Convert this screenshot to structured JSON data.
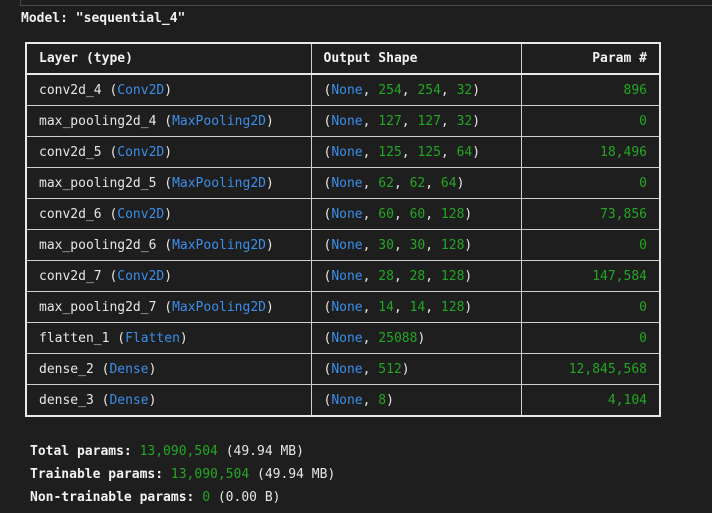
{
  "model_title": "Model: \"sequential_4\"",
  "headers": {
    "layer": "Layer (type)",
    "output_shape": "Output Shape",
    "params": "Param #"
  },
  "rows": [
    {
      "name": "conv2d_4",
      "type": "Conv2D",
      "shape": [
        "None",
        "254",
        "254",
        "32"
      ],
      "params": "896"
    },
    {
      "name": "max_pooling2d_4",
      "type": "MaxPooling2D",
      "shape": [
        "None",
        "127",
        "127",
        "32"
      ],
      "params": "0"
    },
    {
      "name": "conv2d_5",
      "type": "Conv2D",
      "shape": [
        "None",
        "125",
        "125",
        "64"
      ],
      "params": "18,496"
    },
    {
      "name": "max_pooling2d_5",
      "type": "MaxPooling2D",
      "shape": [
        "None",
        "62",
        "62",
        "64"
      ],
      "params": "0"
    },
    {
      "name": "conv2d_6",
      "type": "Conv2D",
      "shape": [
        "None",
        "60",
        "60",
        "128"
      ],
      "params": "73,856"
    },
    {
      "name": "max_pooling2d_6",
      "type": "MaxPooling2D",
      "shape": [
        "None",
        "30",
        "30",
        "128"
      ],
      "params": "0"
    },
    {
      "name": "conv2d_7",
      "type": "Conv2D",
      "shape": [
        "None",
        "28",
        "28",
        "128"
      ],
      "params": "147,584"
    },
    {
      "name": "max_pooling2d_7",
      "type": "MaxPooling2D",
      "shape": [
        "None",
        "14",
        "14",
        "128"
      ],
      "params": "0"
    },
    {
      "name": "flatten_1",
      "type": "Flatten",
      "shape": [
        "None",
        "25088"
      ],
      "params": "0"
    },
    {
      "name": "dense_2",
      "type": "Dense",
      "shape": [
        "None",
        "512"
      ],
      "params": "12,845,568"
    },
    {
      "name": "dense_3",
      "type": "Dense",
      "shape": [
        "None",
        "8"
      ],
      "params": "4,104"
    }
  ],
  "totals": [
    {
      "label": "Total params:",
      "value": "13,090,504",
      "size": "(49.94 MB)"
    },
    {
      "label": "Trainable params:",
      "value": "13,090,504",
      "size": "(49.94 MB)"
    },
    {
      "label": "Non-trainable params:",
      "value": "0",
      "size": "(0.00 B)"
    }
  ],
  "colors": {
    "type_name": "#3b8eea",
    "number": "#23a723",
    "background": "#1e1e1e"
  }
}
